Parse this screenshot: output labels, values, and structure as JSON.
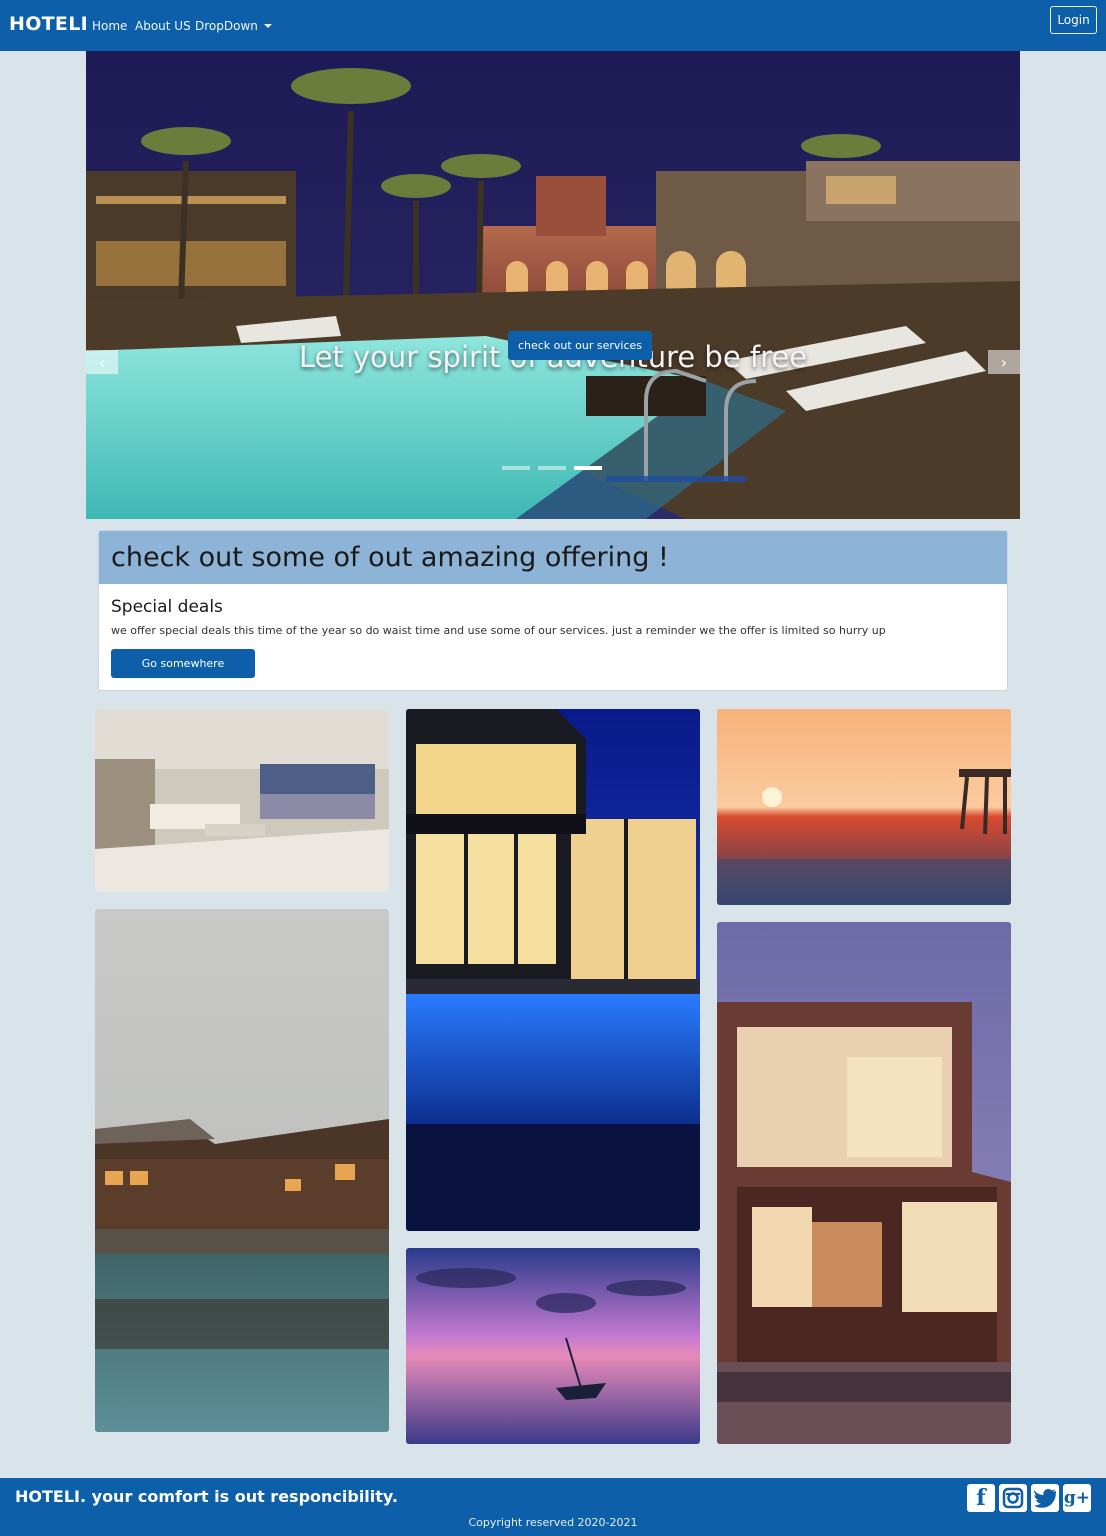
{
  "navbar": {
    "brand": "HOTELI",
    "links": [
      "Home",
      "About US",
      "DropDown"
    ],
    "login_label": "Login"
  },
  "carousel": {
    "caption_title": "Let your spirit of adventure be free",
    "caption_button": "check out our services",
    "prev_glyph": "‹",
    "next_glyph": "›",
    "indicator_count": 3,
    "active_indicator": 3
  },
  "offer": {
    "heading": "check out some of out amazing offering !",
    "title": "Special deals",
    "text": "we offer special deals this time of the year so do waist time and use some of our services. just a reminder we the offer is limited so hurry up",
    "button": "Go somewhere"
  },
  "gallery": {
    "photos": [
      "living-room",
      "lodge-pool",
      "villa-pool-night",
      "boat-sunset",
      "pier-sunset",
      "modern-house"
    ]
  },
  "footer": {
    "tagline": "HOTELI. your comfort is out responcibility.",
    "copyright": "Copyright reserved 2020-2021",
    "social": [
      "f",
      "ig",
      "tw",
      "g+"
    ]
  },
  "colors": {
    "primary": "#0c5fa8",
    "page_bg": "#d8e3ea",
    "offer_header": "#8db4d6"
  }
}
